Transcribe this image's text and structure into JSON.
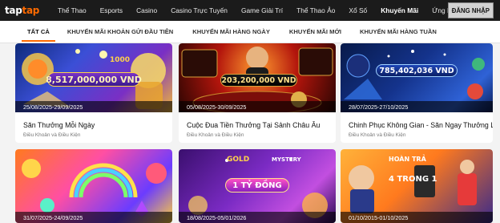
{
  "header": {
    "logo": {
      "part1": "tap",
      "part2": "tap"
    },
    "nav": [
      "Thể Thao",
      "Esports",
      "Casino",
      "Casino Trực Tuyến",
      "Game Giải Trí",
      "Thể Thao Ảo",
      "Xổ Số",
      "Khuyến Mãi",
      "Ứng Dụng"
    ],
    "active_nav": "Khuyến Mãi",
    "login_label": "ĐĂNG NHẬP"
  },
  "tabs": [
    "TẤT CẢ",
    "KHUYẾN MÃI KHOẢN GỬI ĐẦU TIÊN",
    "KHUYẾN MÃI HÀNG NGÀY",
    "KHUYẾN MÃI MỚI",
    "KHUYẾN MÃI HÀNG TUẦN"
  ],
  "active_tab": "TẤT CẢ",
  "promotions": [
    {
      "date": "25/08/2025-29/09/2025",
      "title": "Săn Thưởng Mỗi Ngày",
      "terms": "Điều Khoản và Điều Kiện",
      "amount": "8,517,000,000 VND",
      "small_amount": "1000"
    },
    {
      "date": "05/08/2025-30/09/2025",
      "title": "Cuộc Đua Tiền Thưởng Tại Sảnh Châu Âu",
      "terms": "Điều Khoản và Điều Kiện",
      "amount": "203,200,000 VND"
    },
    {
      "date": "28/07/2025-27/10/2025",
      "title": "Chinh Phục Không Gian - Săn Ngay Thưởng Lớn",
      "terms": "Điều Khoản và Điều Kiện",
      "amount": "785,402,036 VND"
    },
    {
      "date": "31/07/2025-24/09/2025"
    },
    {
      "date": "18/08/2025-05/01/2026",
      "amount": "1 TỶ ĐỒNG",
      "badge_top": "GOLD",
      "badge_mid": "MYSTERY"
    },
    {
      "date": "01/10/2015-01/10/2025",
      "badge_top": "HOÀN TRẢ",
      "badge_mid": "4 TRONG 1"
    }
  ],
  "colors": {
    "accent": "#ff6a00",
    "topbar": "#1b1b1b"
  }
}
